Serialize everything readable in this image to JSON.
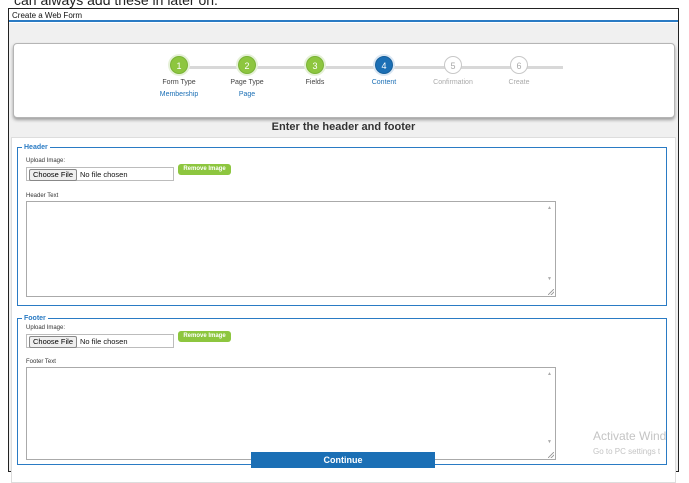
{
  "top_fragment": "can always add these in later on.",
  "window_title": "Create a Web Form",
  "wizard": {
    "steps": [
      {
        "number": "1",
        "label": "Form Type",
        "sub": "Membership",
        "state": "done"
      },
      {
        "number": "2",
        "label": "Page Type",
        "sub": "Page",
        "state": "done"
      },
      {
        "number": "3",
        "label": "Fields",
        "sub": "",
        "state": "done"
      },
      {
        "number": "4",
        "label": "Content",
        "sub": "",
        "state": "current"
      },
      {
        "number": "5",
        "label": "Confirmation",
        "sub": "",
        "state": "todo"
      },
      {
        "number": "6",
        "label": "Create",
        "sub": "",
        "state": "todo"
      }
    ]
  },
  "heading": "Enter the header and footer",
  "header_section": {
    "legend": "Header",
    "upload_label": "Upload Image:",
    "choose_file": "Choose File",
    "no_file": "No file chosen",
    "remove_image": "Remove Image",
    "text_label": "Header Text"
  },
  "footer_section": {
    "legend": "Footer",
    "upload_label": "Upload Image:",
    "choose_file": "Choose File",
    "no_file": "No file chosen",
    "remove_image": "Remove Image",
    "text_label": "Footer Text"
  },
  "continue_label": "Continue",
  "watermark": {
    "line1": "Activate Wind",
    "line2": "Go to PC settings t"
  },
  "colors": {
    "accent_blue": "#1b6fb5",
    "step_green": "#8dc63f",
    "border_blue": "#2a7bc4"
  }
}
